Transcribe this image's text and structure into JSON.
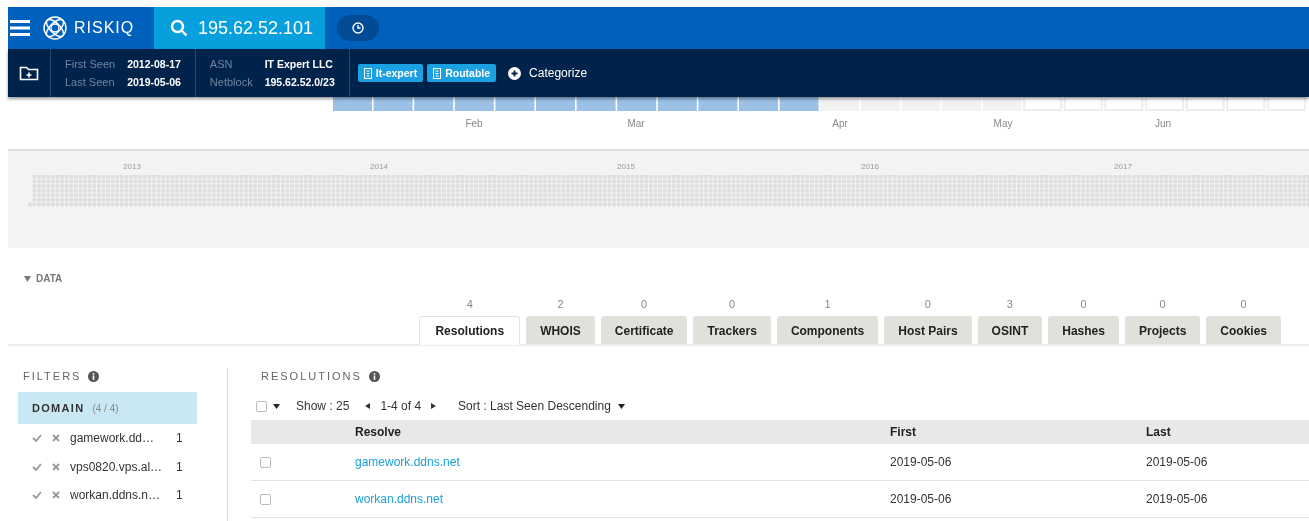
{
  "header": {
    "logo": "RISKIQ",
    "search": "195.62.52.101"
  },
  "info": {
    "groups": [
      [
        {
          "label": "First Seen",
          "value": "2012-08-17"
        },
        {
          "label": "Last Seen",
          "value": "2019-05-06"
        }
      ],
      [
        {
          "label": "ASN",
          "value": "IT Expert LLC"
        },
        {
          "label": "Netblock",
          "value": "195.62.52.0/23"
        }
      ]
    ],
    "tags": [
      "It-expert",
      "Routable"
    ],
    "categorize": "Categorize"
  },
  "timeline": {
    "months": [
      "Feb",
      "Mar",
      "Apr",
      "May",
      "Jun"
    ],
    "years": [
      "2013",
      "2014",
      "2015",
      "2016",
      "2017"
    ]
  },
  "data_section": {
    "title": "DATA",
    "expanded": true
  },
  "tabs": [
    {
      "label": "Resolutions",
      "count": "4",
      "selected": true
    },
    {
      "label": "WHOIS",
      "count": "2",
      "selected": false
    },
    {
      "label": "Certificate",
      "count": "0",
      "selected": false
    },
    {
      "label": "Trackers",
      "count": "0",
      "selected": false
    },
    {
      "label": "Components",
      "count": "1",
      "selected": false
    },
    {
      "label": "Host Pairs",
      "count": "0",
      "selected": false
    },
    {
      "label": "OSINT",
      "count": "3",
      "selected": false
    },
    {
      "label": "Hashes",
      "count": "0",
      "selected": false
    },
    {
      "label": "Projects",
      "count": "0",
      "selected": false
    },
    {
      "label": "Cookies",
      "count": "0",
      "selected": false
    }
  ],
  "filters": {
    "title": "FILTERS",
    "group": {
      "label": "DOMAIN",
      "count": "(4 / 4)"
    },
    "items": [
      {
        "name": "gamework.dd…",
        "count": "1"
      },
      {
        "name": "vps0820.vps.al…",
        "count": "1"
      },
      {
        "name": "workan.ddns.n…",
        "count": "1"
      }
    ]
  },
  "resolutions": {
    "title": "RESOLUTIONS",
    "select_all_checked": false,
    "show": "Show : 25",
    "range": "1-4 of 4",
    "sort": "Sort : Last Seen Descending",
    "columns": [
      "Resolve",
      "First",
      "Last"
    ],
    "rows": [
      {
        "checked": false,
        "resolve": "gamework.ddns.net",
        "first": "2019-05-06",
        "last": "2019-05-06"
      },
      {
        "checked": false,
        "resolve": "workan.ddns.net",
        "first": "2019-05-06",
        "last": "2019-05-06"
      }
    ]
  }
}
